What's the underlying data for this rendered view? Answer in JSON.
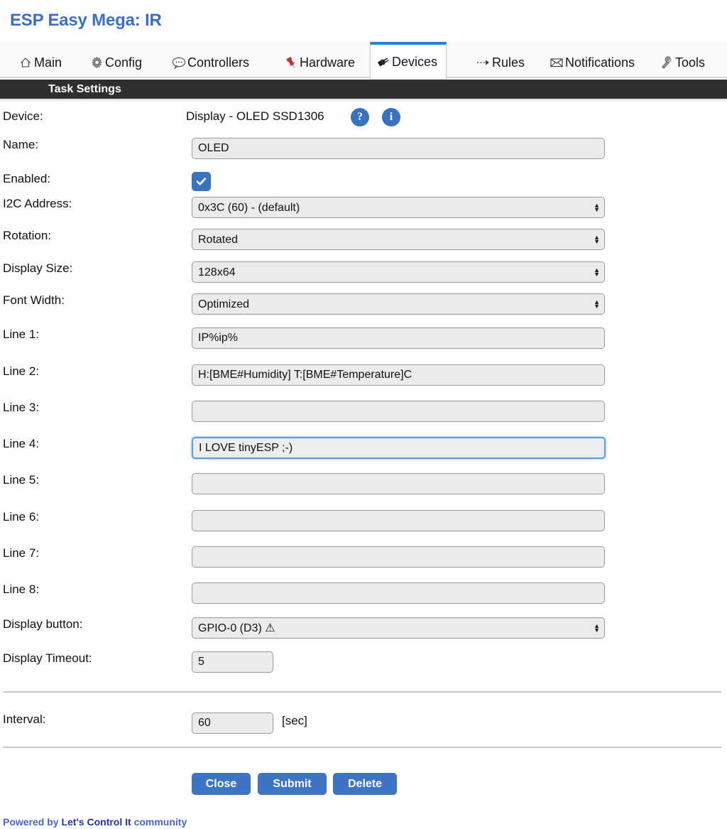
{
  "header": {
    "title": "ESP Easy Mega: IR"
  },
  "tabs": [
    {
      "label": "Main",
      "icon": "home-icon",
      "active": false
    },
    {
      "label": "Config",
      "icon": "gear-icon",
      "active": false
    },
    {
      "label": "Controllers",
      "icon": "speech-bubble-icon",
      "active": false
    },
    {
      "label": "Hardware",
      "icon": "pushpin-icon",
      "active": false
    },
    {
      "label": "Devices",
      "icon": "plug-icon",
      "active": true
    },
    {
      "label": "Rules",
      "icon": "arrow-icon",
      "active": false
    },
    {
      "label": "Notifications",
      "icon": "envelope-icon",
      "active": false
    },
    {
      "label": "Tools",
      "icon": "wrench-icon",
      "active": false
    }
  ],
  "section": {
    "title": "Task Settings"
  },
  "form": {
    "device": {
      "label": "Device:",
      "value": "Display - OLED SSD1306",
      "help_badge": "?",
      "info_badge": "i"
    },
    "name": {
      "label": "Name:",
      "value": "OLED",
      "placeholder": ""
    },
    "enabled": {
      "label": "Enabled:",
      "checked": true
    },
    "i2c_address": {
      "label": "I2C Address:",
      "value": "0x3C (60) - (default)"
    },
    "rotation": {
      "label": "Rotation:",
      "value": "Rotated"
    },
    "display_size": {
      "label": "Display Size:",
      "value": "128x64"
    },
    "font_width": {
      "label": "Font Width:",
      "value": "Optimized"
    },
    "lines": [
      {
        "label": "Line 1:",
        "value": "IP%ip%",
        "focused": false
      },
      {
        "label": "Line 2:",
        "value": "H:[BME#Humidity] T:[BME#Temperature]C",
        "focused": false
      },
      {
        "label": "Line 3:",
        "value": "",
        "focused": false
      },
      {
        "label": "Line 4:",
        "value": "I LOVE tinyESP ;-)",
        "focused": true
      },
      {
        "label": "Line 5:",
        "value": "",
        "focused": false
      },
      {
        "label": "Line 6:",
        "value": "",
        "focused": false
      },
      {
        "label": "Line 7:",
        "value": "",
        "focused": false
      },
      {
        "label": "Line 8:",
        "value": "",
        "focused": false
      }
    ],
    "display_button": {
      "label": "Display button:",
      "value": "GPIO-0 (D3) ⚠"
    },
    "display_timeout": {
      "label": "Display Timeout:",
      "value": "5"
    },
    "interval": {
      "label": "Interval:",
      "value": "60",
      "unit": "[sec]"
    }
  },
  "buttons": {
    "close": "Close",
    "submit": "Submit",
    "delete": "Delete"
  },
  "footer": {
    "prefix": "Powered by ",
    "brand": "Let's Control It",
    "suffix": " community"
  },
  "colors": {
    "title_blue": "#3c6ec9",
    "tab_active_top": "#2b7fd4",
    "section_bar": "#2f2f2f",
    "accent_blue": "#3a72bf",
    "button_blue": "#3f73c4",
    "input_bg": "#ebebeb",
    "footer_blue": "#3c4fc9"
  }
}
